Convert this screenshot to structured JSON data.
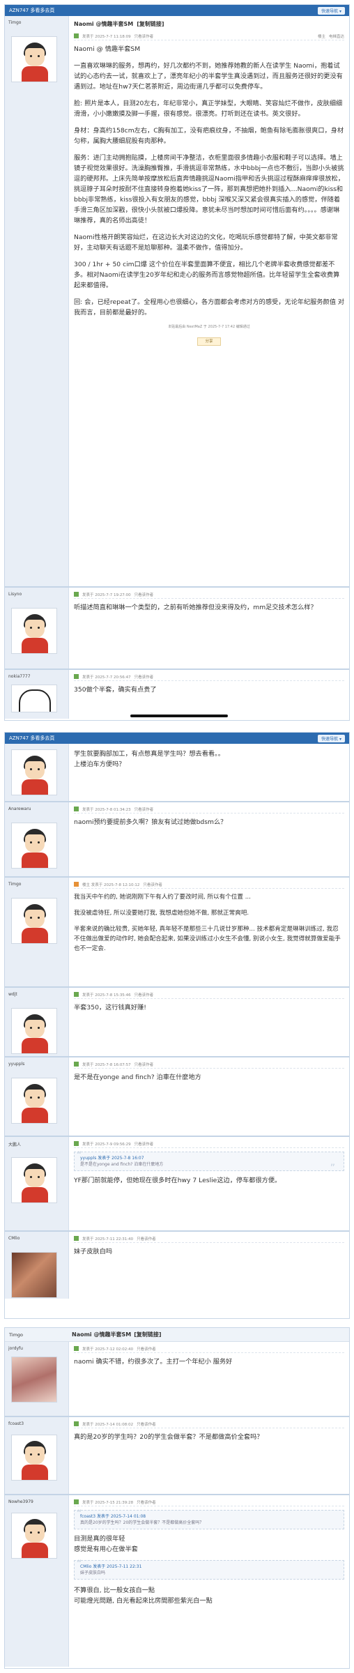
{
  "app": {
    "site_name": "AZN747 多看多去頁",
    "quick_reply": "快速导航 ▾"
  },
  "thread": {
    "title": "Naomi @情趣半套SM",
    "copy_link": "[复制链接]",
    "view_mode": "楼主",
    "view_all": "电梯直达",
    "reply_label": "只看该作者"
  },
  "posts": [
    {
      "user": "Timgo",
      "date": "发表于 2025-7-7 11:18:09",
      "floor": "楼主",
      "title": "Naomi @情趣半套SM",
      "paragraphs": [
        "Naomi @ 情趣半套SM",
        "一直喜欢琳琳的服务，想再约，好几次都约不到，她推荐她教的新人在读学生 Naomi，抱着试试的心态约去一试，就喜欢上了，漂亮年纪小的半套学生真没遇到过，而且服务还很好的更没有遇到过。地址在hw7天仁茗茶附近，周边街道几乎都可以免费停车。",
        "脸: 照片是本人，目测20左右，年纪非常小，真正学妹型，大眼睛、笑容灿烂不做作，皮肤细细滑滑，小小嫩嫩摸及脚一手握，很有感觉。很漂亮。打听到还在读书。英文很好。",
        "身材：身高约158cm左右，C胸有加工，没有疤痕纹身，不抽烟，鲍鱼有除毛膨胀很爽口，身材匀称，属胸大腰细屁股有肉那种。",
        "服务：进门主动拥抱贴摸，上楼房间干净整洁，衣柜里面很多情趣小衣服和鞋子可以选择。墙上镜子视觉效果很好。洗澡胸推臀推，手滑挑逗非常熟练，水中bbbj一点也不敷衍，当即小头被挑逗的硬邦邦。上床先简单按摩放松后直奔情趣挑逗Naomi指甲和舌头挑逗过程酥麻痒痒很放松，挑逗脖子耳朵时按耐不住直接转身抱着她kiss了一阵，那到真想把她扑到插入…Naomi的kiss和bbbj非常熟练，kiss很投入有女朋友的感觉，bbbj 深喉又深又紧会很真实插入的感觉，伴随着手滑三角区加深戳，很快小头就被口爆投降。意犹未尽当时想加时间可惜后面有约。。。。感谢琳琳推荐，真的名师出高徒！",
        "Naomi性格开朗笑容灿烂，在这边长大对这边的文化，吃喝玩乐感觉都特了解，中英文都非常好，主动聊天有话题不是尬聊那种。温柔不做作，值得加分。",
        "300 / 1hr + 50 cim口爆 这个价位在半套里面算不便宜，相比几个老牌半套收费感觉都差不多。相对Naomi在读学生20岁年纪和走心的服务而言感觉物超所值。比年轻留学生全套收费算起来都值得。",
        "回: 会，已经repeat了。全程用心也很细心，各方面都会考虑对方的感受，无论年纪服务颜值 对我而言，目前都是最好的。"
      ],
      "last_edit": "本贴最后由 NextMaZ 于 2025-7-7 17:42 编辑通过",
      "share": "分享"
    },
    {
      "user": "Lisyno",
      "date": "发表于 2025-7-7 19:27:00",
      "title": "",
      "paragraphs": [
        "听描述简直和琳琳一个类型的，之前有听她推荐但没来得及约，mm足交技术怎么样？"
      ]
    },
    {
      "user": "nokia7777",
      "date": "发表于 2025-7-7 20:56:47",
      "title": "",
      "paragraphs": [
        "350做个半套，确实有点贵了"
      ]
    },
    {
      "user": "",
      "date": "",
      "title": "",
      "paragraphs": [
        "学生就要胸部加工，有点憋真是学生吗？想去看看。。",
        "上楼泊车方便吗？"
      ]
    },
    {
      "user": "Anarewaru",
      "date": "发表于 2025-7-8 01:34:23",
      "title": "",
      "paragraphs": [
        "naomi预约要提前多久啊？狼友有试过她做bdsm么？"
      ]
    },
    {
      "user": "Timgo",
      "date": "楼主 发表于 2025-7-8 12:10:12",
      "title": "",
      "paragraphs": [
        "我当天中午约的, 她说刚刚下午有人约了要改时间, 所以有个位置 ...",
        "我没被虐待狂, 所以没要她打我, 我想虐她但她不做, 那就正常爽吧.",
        "半套来说的确比较贵, 买她年轻, 真年轻不是那些三十几说廿岁那种... 技术都肯定是琳琳训练过, 我忍不住做出做爱的动作时, 她会配合起来, 如果没训练过小女生不会懂, 别说小女生, 我觉得就算做爱能手也不一定会."
      ]
    },
    {
      "user": "wdjt",
      "date": "发表于 2025-7-8 15:35:46",
      "title": "",
      "paragraphs": [
        "半套350，这行钱真好赚!"
      ]
    },
    {
      "user": "yyuppls",
      "date": "发表于 2025-7-8 16:07:57",
      "title": "",
      "paragraphs": [
        "是不是在yonge and finch? 泊車在什麼地方"
      ]
    },
    {
      "user": "大鹏人",
      "date": "发表于 2025-7-9 09:56:29",
      "title": "",
      "quote": {
        "name": "yyuppls 发表于 2025-7-8 16:07",
        "text": "是不是在yonge and finch? 泊車在什麼地方"
      },
      "paragraphs": [
        "YF那门前就能停，但她现在很多时在hwy 7 Leslie这边，停车都很方便。"
      ]
    },
    {
      "user": "CMlio",
      "date": "发表于 2025-7-11 22:31:40",
      "title": "",
      "paragraphs": [
        "妹子皮肤白吗"
      ]
    },
    {
      "user": "jordyfu",
      "date": "发表于 2025-7-12 02:02:40",
      "title": "",
      "paragraphs": [
        "naomi 确实不错，约很多次了。主打一个年纪小 服务好"
      ]
    },
    {
      "user": "fcoast3",
      "date": "发表于 2025-7-14 01:08:02",
      "title": "",
      "paragraphs": [
        "真的是20岁的学生吗？20的学生会做半套？不是都做高价全套吗？"
      ]
    },
    {
      "user": "Nowhe3979",
      "date": "发表于 2025-7-15 21:39:28",
      "title": "",
      "quote": {
        "name": "fcoast3 发表于 2025-7-14 01:08",
        "text": "真的是20岁的学生吗？20的学生会做半套？不是都做高价全套吗？"
      },
      "quote2": {
        "name": "CMlio 发表于 2025-7-11 22:31",
        "text": "妹子皮肤白吗"
      },
      "paragraphs": [
        "目测是真的很年轻",
        "感觉是有用心在做半套",
        "",
        "不算很白, 比一般女孩白一點",
        "可能燈光問題, 白光看起來比房間那些紫光白一點"
      ]
    }
  ]
}
